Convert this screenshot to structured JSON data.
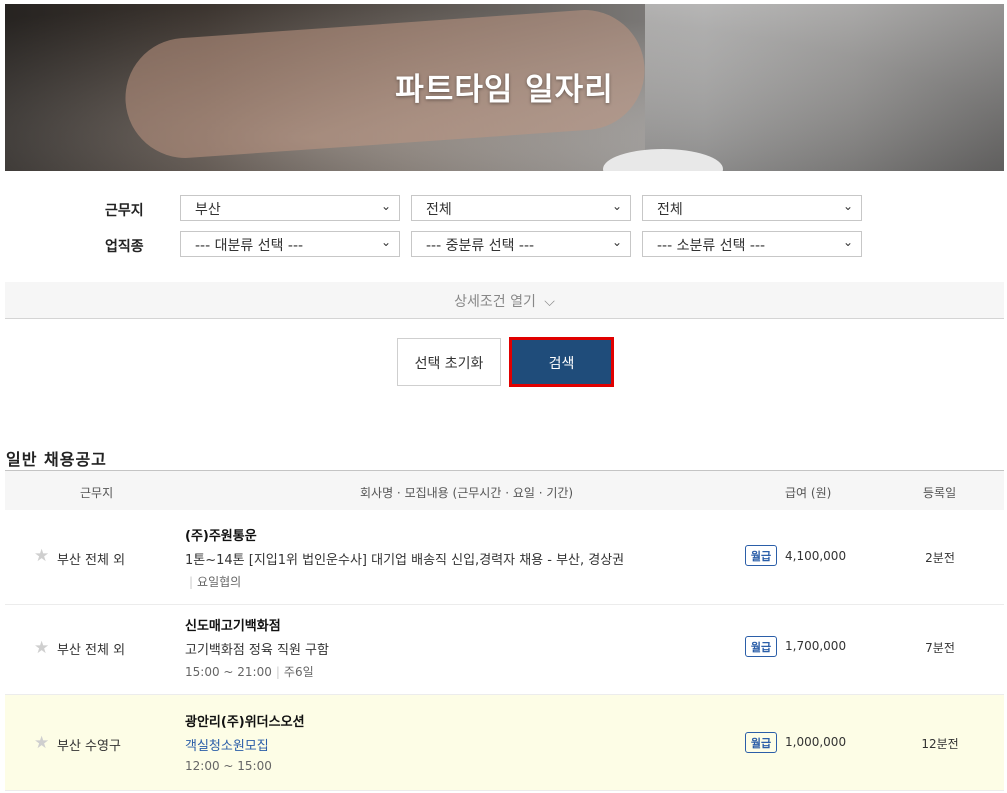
{
  "hero": {
    "title": "파트타임 일자리"
  },
  "filters": {
    "region_label": "근무지",
    "job_label": "업직종",
    "region_selects": [
      "부산",
      "전체",
      "전체"
    ],
    "job_selects": [
      "--- 대분류 선택 ---",
      "--- 중분류 선택 ---",
      "--- 소분류 선택 ---"
    ],
    "chevron": "⌄"
  },
  "detail": {
    "label": "상세조건 열기",
    "icon": "chevron-down-icon",
    "glyph": "⌵"
  },
  "buttons": {
    "reset": "선택 초기화",
    "search": "검색"
  },
  "section": {
    "title": "일반 채용공고"
  },
  "table": {
    "headers": [
      "근무지",
      "회사명 · 모집내용 (근무시간 · 요일 · 기간)",
      "급여 (원)",
      "등록일"
    ],
    "rows": [
      {
        "location": "부산 전체 외",
        "company": "(주)주원통운",
        "title": "1톤~14톤 [지입1위 법인운수사] 대기업 배송직 신입,경력자 채용 - 부산, 경상권",
        "meta": [
          "요일협의"
        ],
        "pay_type": "월급",
        "pay": "4,100,000",
        "posted": "2분전",
        "highlight": false
      },
      {
        "location": "부산 전체 외",
        "company": "신도매고기백화점",
        "title": "고기백화점 정육 직원 구함",
        "meta": [
          "15:00 ~ 21:00",
          "주6일"
        ],
        "pay_type": "월급",
        "pay": "1,700,000",
        "posted": "7분전",
        "highlight": false
      },
      {
        "location": "부산 수영구",
        "company": "광안리(주)위더스오션",
        "title": "객실청소원모집",
        "meta": [
          "12:00 ~ 15:00"
        ],
        "pay_type": "월급",
        "pay": "1,000,000",
        "posted": "12분전",
        "highlight": true
      }
    ]
  },
  "colors": {
    "primary": "#1f4c7a",
    "highlight_border": "#e00000",
    "link": "#2b5ea8",
    "row_highlight": "#fdfde6"
  }
}
